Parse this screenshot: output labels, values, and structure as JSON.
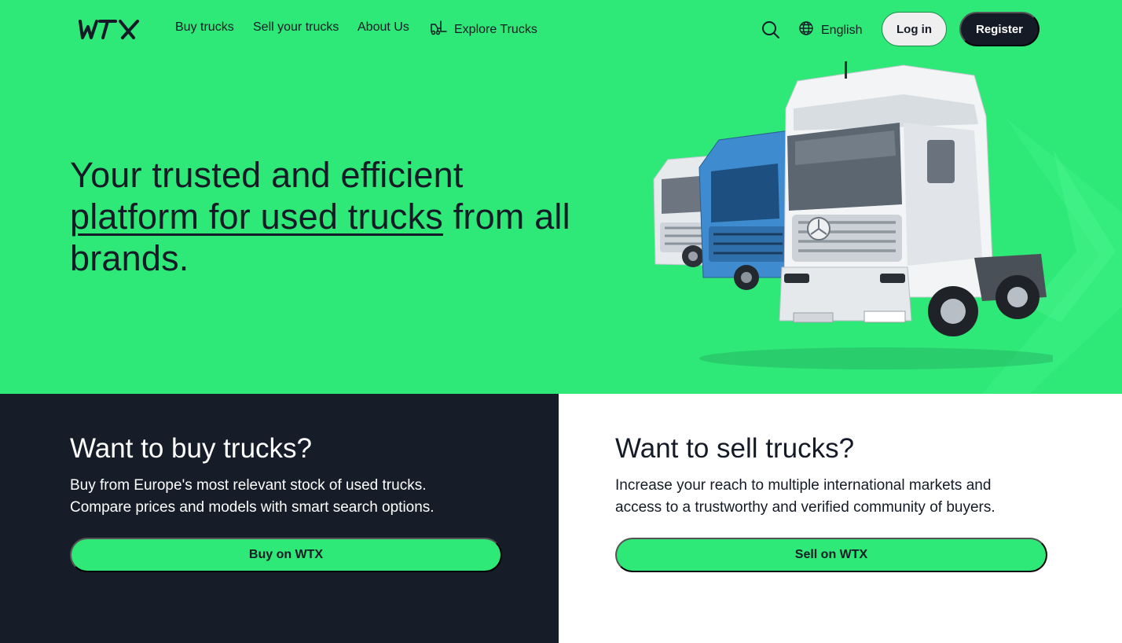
{
  "colors": {
    "brand_green": "#2ee878",
    "dark": "#151b26",
    "white": "#ffffff"
  },
  "nav": {
    "logo_text": "WTX",
    "links": [
      {
        "label": "Buy trucks"
      },
      {
        "label": "Sell your trucks"
      },
      {
        "label": "About Us"
      },
      {
        "label": "Explore Trucks",
        "icon": "forklift-icon"
      }
    ],
    "search_icon": "search-icon",
    "language": {
      "label": "English",
      "icon": "globe-icon"
    },
    "login_label": "Log in",
    "register_label": "Register"
  },
  "hero": {
    "headline_start": "Your trusted and efficient",
    "headline_link": "platform for used trucks",
    "headline_end": " from all brands.",
    "image": "trucks-image"
  },
  "buy": {
    "title": "Want to buy trucks?",
    "text": "Buy from Europe's most relevant stock of used trucks.\nCompare prices and models with smart search options.",
    "cta": "Buy on WTX"
  },
  "sell": {
    "title": "Want to sell trucks?",
    "text": "Increase your reach to multiple international markets and\naccess to a trustworthy and verified community of buyers.",
    "cta": "Sell on WTX"
  }
}
